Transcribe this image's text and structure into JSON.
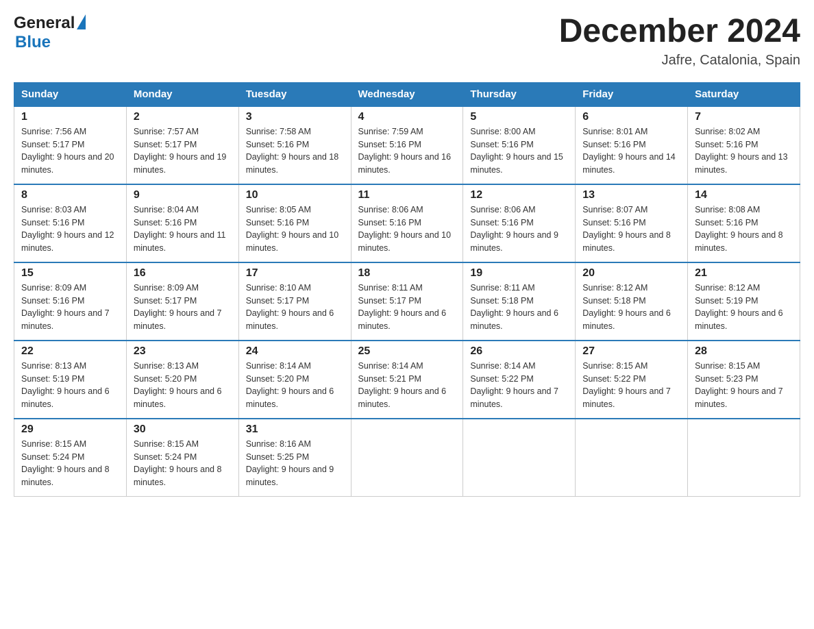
{
  "header": {
    "month": "December 2024",
    "location": "Jafre, Catalonia, Spain",
    "logo_general": "General",
    "logo_blue": "Blue"
  },
  "days_of_week": [
    "Sunday",
    "Monday",
    "Tuesday",
    "Wednesday",
    "Thursday",
    "Friday",
    "Saturday"
  ],
  "weeks": [
    [
      {
        "day": "1",
        "sunrise": "7:56 AM",
        "sunset": "5:17 PM",
        "daylight": "9 hours and 20 minutes."
      },
      {
        "day": "2",
        "sunrise": "7:57 AM",
        "sunset": "5:17 PM",
        "daylight": "9 hours and 19 minutes."
      },
      {
        "day": "3",
        "sunrise": "7:58 AM",
        "sunset": "5:16 PM",
        "daylight": "9 hours and 18 minutes."
      },
      {
        "day": "4",
        "sunrise": "7:59 AM",
        "sunset": "5:16 PM",
        "daylight": "9 hours and 16 minutes."
      },
      {
        "day": "5",
        "sunrise": "8:00 AM",
        "sunset": "5:16 PM",
        "daylight": "9 hours and 15 minutes."
      },
      {
        "day": "6",
        "sunrise": "8:01 AM",
        "sunset": "5:16 PM",
        "daylight": "9 hours and 14 minutes."
      },
      {
        "day": "7",
        "sunrise": "8:02 AM",
        "sunset": "5:16 PM",
        "daylight": "9 hours and 13 minutes."
      }
    ],
    [
      {
        "day": "8",
        "sunrise": "8:03 AM",
        "sunset": "5:16 PM",
        "daylight": "9 hours and 12 minutes."
      },
      {
        "day": "9",
        "sunrise": "8:04 AM",
        "sunset": "5:16 PM",
        "daylight": "9 hours and 11 minutes."
      },
      {
        "day": "10",
        "sunrise": "8:05 AM",
        "sunset": "5:16 PM",
        "daylight": "9 hours and 10 minutes."
      },
      {
        "day": "11",
        "sunrise": "8:06 AM",
        "sunset": "5:16 PM",
        "daylight": "9 hours and 10 minutes."
      },
      {
        "day": "12",
        "sunrise": "8:06 AM",
        "sunset": "5:16 PM",
        "daylight": "9 hours and 9 minutes."
      },
      {
        "day": "13",
        "sunrise": "8:07 AM",
        "sunset": "5:16 PM",
        "daylight": "9 hours and 8 minutes."
      },
      {
        "day": "14",
        "sunrise": "8:08 AM",
        "sunset": "5:16 PM",
        "daylight": "9 hours and 8 minutes."
      }
    ],
    [
      {
        "day": "15",
        "sunrise": "8:09 AM",
        "sunset": "5:16 PM",
        "daylight": "9 hours and 7 minutes."
      },
      {
        "day": "16",
        "sunrise": "8:09 AM",
        "sunset": "5:17 PM",
        "daylight": "9 hours and 7 minutes."
      },
      {
        "day": "17",
        "sunrise": "8:10 AM",
        "sunset": "5:17 PM",
        "daylight": "9 hours and 6 minutes."
      },
      {
        "day": "18",
        "sunrise": "8:11 AM",
        "sunset": "5:17 PM",
        "daylight": "9 hours and 6 minutes."
      },
      {
        "day": "19",
        "sunrise": "8:11 AM",
        "sunset": "5:18 PM",
        "daylight": "9 hours and 6 minutes."
      },
      {
        "day": "20",
        "sunrise": "8:12 AM",
        "sunset": "5:18 PM",
        "daylight": "9 hours and 6 minutes."
      },
      {
        "day": "21",
        "sunrise": "8:12 AM",
        "sunset": "5:19 PM",
        "daylight": "9 hours and 6 minutes."
      }
    ],
    [
      {
        "day": "22",
        "sunrise": "8:13 AM",
        "sunset": "5:19 PM",
        "daylight": "9 hours and 6 minutes."
      },
      {
        "day": "23",
        "sunrise": "8:13 AM",
        "sunset": "5:20 PM",
        "daylight": "9 hours and 6 minutes."
      },
      {
        "day": "24",
        "sunrise": "8:14 AM",
        "sunset": "5:20 PM",
        "daylight": "9 hours and 6 minutes."
      },
      {
        "day": "25",
        "sunrise": "8:14 AM",
        "sunset": "5:21 PM",
        "daylight": "9 hours and 6 minutes."
      },
      {
        "day": "26",
        "sunrise": "8:14 AM",
        "sunset": "5:22 PM",
        "daylight": "9 hours and 7 minutes."
      },
      {
        "day": "27",
        "sunrise": "8:15 AM",
        "sunset": "5:22 PM",
        "daylight": "9 hours and 7 minutes."
      },
      {
        "day": "28",
        "sunrise": "8:15 AM",
        "sunset": "5:23 PM",
        "daylight": "9 hours and 7 minutes."
      }
    ],
    [
      {
        "day": "29",
        "sunrise": "8:15 AM",
        "sunset": "5:24 PM",
        "daylight": "9 hours and 8 minutes."
      },
      {
        "day": "30",
        "sunrise": "8:15 AM",
        "sunset": "5:24 PM",
        "daylight": "9 hours and 8 minutes."
      },
      {
        "day": "31",
        "sunrise": "8:16 AM",
        "sunset": "5:25 PM",
        "daylight": "9 hours and 9 minutes."
      },
      null,
      null,
      null,
      null
    ]
  ],
  "sunrise_label": "Sunrise:",
  "sunset_label": "Sunset:",
  "daylight_label": "Daylight:"
}
